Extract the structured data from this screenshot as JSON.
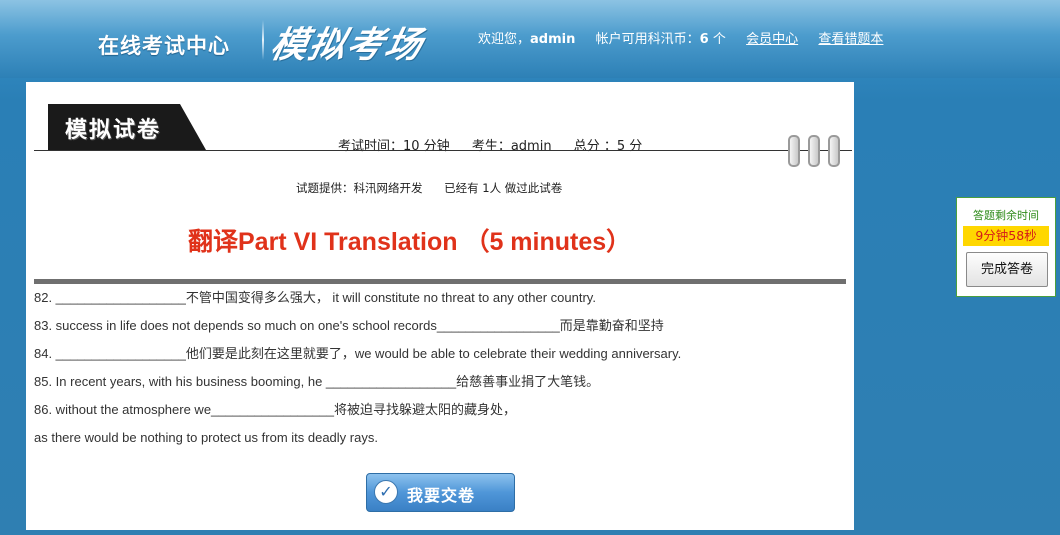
{
  "header": {
    "site_title": "在线考试中心",
    "logo_text": "模拟考场",
    "welcome_prefix": "欢迎您，",
    "username": "admin",
    "coins_prefix": "帐户可用科汛币：",
    "coins_value": "6",
    "coins_unit": " 个",
    "member_center_link": "会员中心",
    "wrong_book_link": "查看错题本"
  },
  "paper": {
    "label": "模拟试卷",
    "exam_time": "考试时间：10 分钟",
    "examinee": "考生：admin",
    "total_score": "总分 ：5 分",
    "provider": "试题提供：科汛网络开发",
    "taken_count": "已经有 1人 做过此试卷",
    "section_title": "翻译Part VI Translation  （5 minutes）",
    "questions": [
      "82. __________________不管中国变得多么强大， it will constitute no threat to any other country.",
      "83. success in life does not depends so much on one's school records_________________而是靠勤奋和坚持",
      "84. __________________他们要是此刻在这里就要了，we would be able to celebrate their wedding anniversary.",
      "85. In recent years, with his business booming, he __________________给慈善事业捐了大笔钱。",
      "86. without the atmosphere we_________________将被迫寻找躲避太阳的藏身处，",
      "as there would be nothing to protect us from its deadly rays."
    ],
    "submit_label": "我要交卷"
  },
  "timer": {
    "label": "答题剩余时间",
    "remaining": "9分钟58秒",
    "finish_label": "完成答卷"
  },
  "colors": {
    "section_title": "#e0321a",
    "timer_highlight": "#ffd700",
    "timer_text": "#d41a1a",
    "timer_border": "#4b9f3e"
  }
}
